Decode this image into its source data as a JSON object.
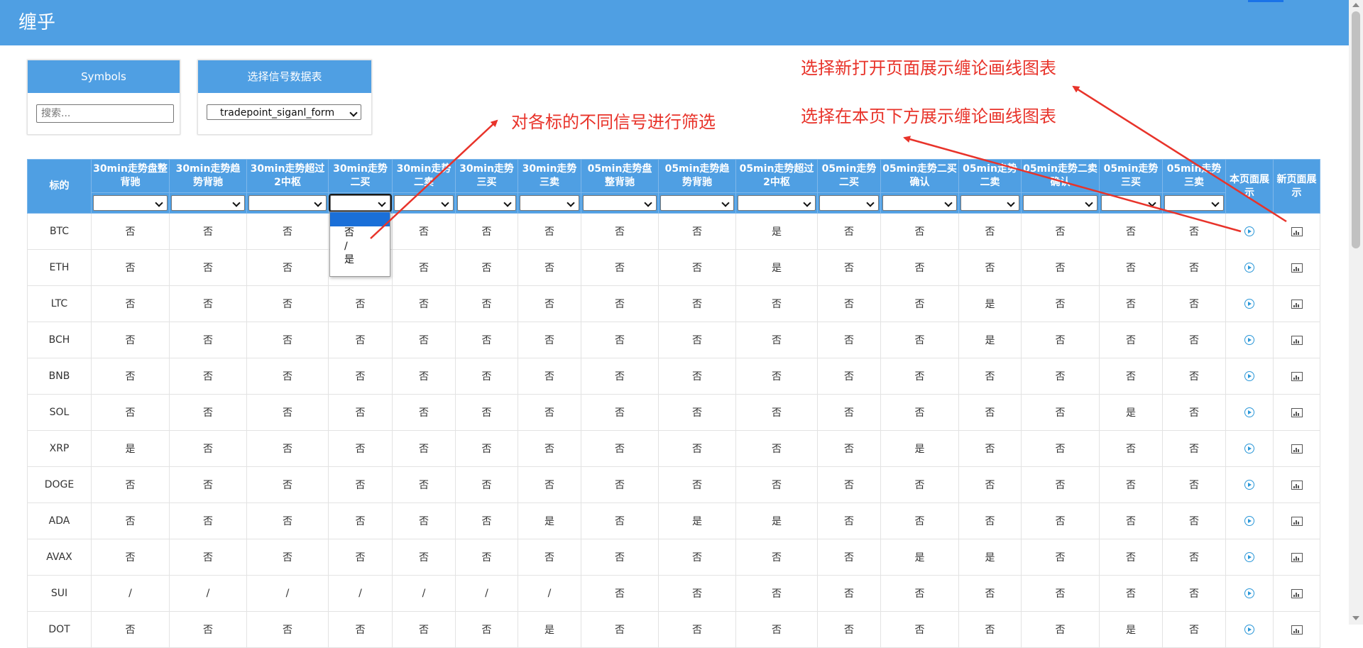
{
  "app": {
    "title": "缠乎"
  },
  "symbols_panel": {
    "title": "Symbols",
    "search_placeholder": "搜索..."
  },
  "signal_panel": {
    "title": "选择信号数据表",
    "selected": "tradepoint_siganl_form"
  },
  "table": {
    "columns": [
      "标的",
      "30min走势盘整背驰",
      "30min走势趋势背驰",
      "30min走势超过2中枢",
      "30min走势二买",
      "30min走势二卖",
      "30min走势三买",
      "30min走势三卖",
      "05min走势盘整背驰",
      "05min走势趋势背驰",
      "05min走势超过2中枢",
      "05min走势二买",
      "05min走势二买确认",
      "05min走势二卖",
      "05min走势二卖确认",
      "05min走势三买",
      "05min走势三卖",
      "本页面展示",
      "新页面展示"
    ],
    "rows": [
      {
        "symbol": "BTC",
        "cells": [
          "否",
          "否",
          "否",
          "",
          "否",
          "否",
          "否",
          "否",
          "否",
          "是",
          "否",
          "否",
          "否",
          "否",
          "否",
          "否"
        ]
      },
      {
        "symbol": "ETH",
        "cells": [
          "否",
          "否",
          "否",
          "",
          "否",
          "否",
          "否",
          "否",
          "否",
          "是",
          "否",
          "否",
          "否",
          "否",
          "否",
          "否"
        ]
      },
      {
        "symbol": "LTC",
        "cells": [
          "否",
          "否",
          "否",
          "否",
          "否",
          "否",
          "否",
          "否",
          "否",
          "否",
          "否",
          "否",
          "是",
          "否",
          "否",
          "否"
        ]
      },
      {
        "symbol": "BCH",
        "cells": [
          "否",
          "否",
          "否",
          "否",
          "否",
          "否",
          "否",
          "否",
          "否",
          "否",
          "否",
          "否",
          "是",
          "否",
          "否",
          "否"
        ]
      },
      {
        "symbol": "BNB",
        "cells": [
          "否",
          "否",
          "否",
          "否",
          "否",
          "否",
          "否",
          "否",
          "否",
          "否",
          "否",
          "否",
          "否",
          "否",
          "否",
          "否"
        ]
      },
      {
        "symbol": "SOL",
        "cells": [
          "否",
          "否",
          "否",
          "否",
          "否",
          "否",
          "否",
          "否",
          "否",
          "否",
          "否",
          "否",
          "否",
          "否",
          "是",
          "否"
        ]
      },
      {
        "symbol": "XRP",
        "cells": [
          "是",
          "否",
          "否",
          "否",
          "否",
          "否",
          "否",
          "否",
          "否",
          "否",
          "否",
          "是",
          "否",
          "否",
          "否",
          "否"
        ]
      },
      {
        "symbol": "DOGE",
        "cells": [
          "否",
          "否",
          "否",
          "否",
          "否",
          "否",
          "否",
          "否",
          "否",
          "否",
          "否",
          "否",
          "否",
          "否",
          "否",
          "否"
        ]
      },
      {
        "symbol": "ADA",
        "cells": [
          "否",
          "否",
          "否",
          "否",
          "否",
          "否",
          "是",
          "否",
          "是",
          "是",
          "否",
          "否",
          "否",
          "否",
          "否",
          "否"
        ]
      },
      {
        "symbol": "AVAX",
        "cells": [
          "否",
          "否",
          "否",
          "否",
          "否",
          "否",
          "否",
          "否",
          "否",
          "否",
          "否",
          "是",
          "是",
          "否",
          "否",
          "否"
        ]
      },
      {
        "symbol": "SUI",
        "cells": [
          "/",
          "/",
          "/",
          "/",
          "/",
          "/",
          "/",
          "否",
          "否",
          "否",
          "否",
          "否",
          "否",
          "否",
          "否",
          "否"
        ]
      },
      {
        "symbol": "DOT",
        "cells": [
          "否",
          "否",
          "否",
          "否",
          "否",
          "否",
          "是",
          "否",
          "否",
          "否",
          "否",
          "否",
          "否",
          "否",
          "是",
          "否"
        ]
      }
    ]
  },
  "dropdown": {
    "options": [
      "",
      "否",
      "/",
      "是"
    ]
  },
  "annotations": {
    "filter": "对各标的不同信号进行筛选",
    "new_page": "选择新打开页面展示缠论画线图表",
    "this_page": "选择在本页下方展示缠论画线图表"
  },
  "icons": {
    "this_page": "play-circle-icon",
    "new_page": "chart-icon"
  },
  "colors": {
    "header": "#4f9fe3",
    "annotation": "#e8332a",
    "link_icon": "#2a97d8"
  }
}
